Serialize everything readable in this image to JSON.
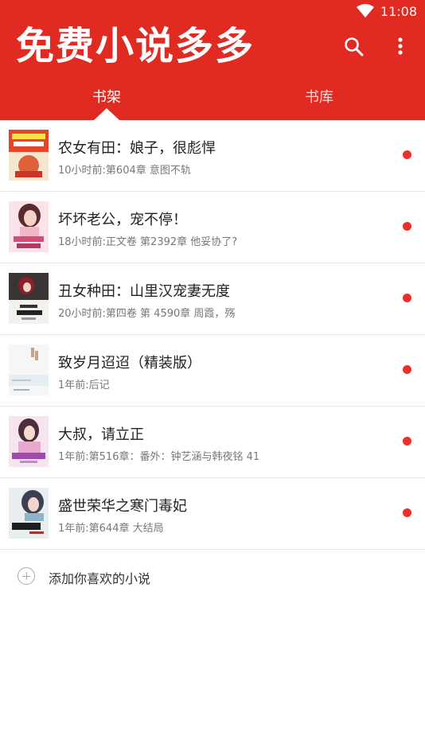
{
  "status_bar": {
    "time": "11:08"
  },
  "header": {
    "app_title": "免费小说多多",
    "tabs": [
      {
        "label": "书架",
        "selected": true
      },
      {
        "label": "书库",
        "selected": false
      }
    ]
  },
  "books": [
    {
      "title": "农女有田：娘子，很彪悍",
      "latest": "10小时前:第604章 意图不轨",
      "has_update": true
    },
    {
      "title": "坏坏老公，宠不停！",
      "latest": "18小时前:正文卷 第2392章 他妥协了?",
      "has_update": true
    },
    {
      "title": "丑女种田：山里汉宠妻无度",
      "latest": "20小时前:第四卷 第 4590章 周霞，殇",
      "has_update": true
    },
    {
      "title": "致岁月迢迢（精装版）",
      "latest": "1年前:后记",
      "has_update": true
    },
    {
      "title": "大叔，请立正",
      "latest": "1年前:第516章：番外：钟艺涵与韩夜铭 41",
      "has_update": true
    },
    {
      "title": "盛世荣华之寒门毒妃",
      "latest": "1年前:第644章 大结局",
      "has_update": true
    }
  ],
  "add_book": {
    "label": "添加你喜欢的小说"
  },
  "colors": {
    "brand_red": "#e02a22",
    "dot_red": "#e8302b"
  }
}
